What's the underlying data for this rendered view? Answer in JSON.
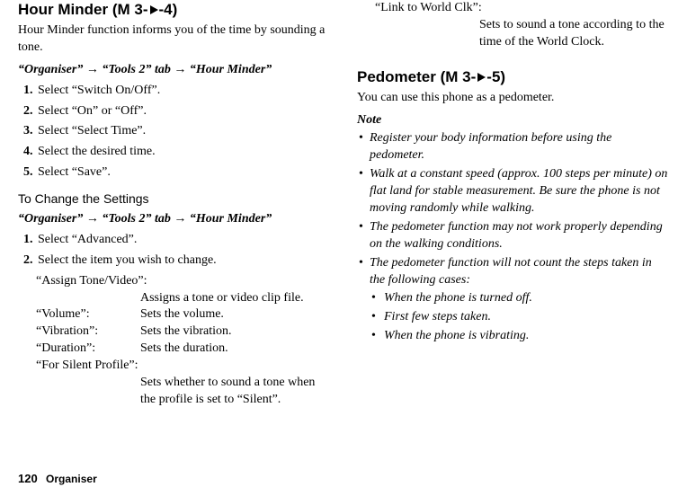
{
  "col1": {
    "heading": "Hour Minder",
    "code_prefix": "(M 3-",
    "code_suffix": "-4)",
    "intro": "Hour Minder function informs you of the time by sounding a tone.",
    "breadcrumb": "“Organiser” → “Tools 2” tab → “Hour Minder”",
    "steps": [
      "Select “Switch On/Off”.",
      "Select “On” or “Off”.",
      "Select “Select Time”.",
      "Select the desired time.",
      "Select “Save”."
    ],
    "sub_heading": "To Change the Settings",
    "breadcrumb2": "“Organiser” → “Tools 2” tab → “Hour Minder”",
    "steps2": [
      "Select “Advanced”.",
      "Select the item you wish to change."
    ],
    "defs": [
      {
        "label": "“Assign Tone/Video”:",
        "full": true,
        "value": "Assigns a tone or video clip file."
      },
      {
        "label": "“Volume”:",
        "value": "Sets the volume."
      },
      {
        "label": "“Vibration”:",
        "value": "Sets the vibration."
      },
      {
        "label": "“Duration”:",
        "value": "Sets the duration."
      },
      {
        "label": "“For Silent Profile”:",
        "full": true,
        "value": "Sets whether to sound a tone when the profile is set to “Silent”."
      }
    ]
  },
  "col2": {
    "top_label": "“Link to World Clk”:",
    "top_value": "Sets to sound a tone according to the time of the World Clock.",
    "heading": "Pedometer",
    "code_prefix": "(M 3-",
    "code_suffix": "-5)",
    "intro": "You can use this phone as a pedometer.",
    "note_title": "Note",
    "notes": [
      "Register your body information before using the pedometer.",
      "Walk at a constant speed (approx. 100 steps per minute) on flat land for stable measurement. Be sure the phone is not moving randomly while walking.",
      "The pedometer function may not work properly depending on the walking conditions.",
      "The pedometer function will not count the steps taken in the following cases:"
    ],
    "sub_notes": [
      "When the phone is turned off.",
      "First few steps taken.",
      "When the phone is vibrating."
    ]
  },
  "footer": {
    "page": "120",
    "section": "Organiser"
  }
}
